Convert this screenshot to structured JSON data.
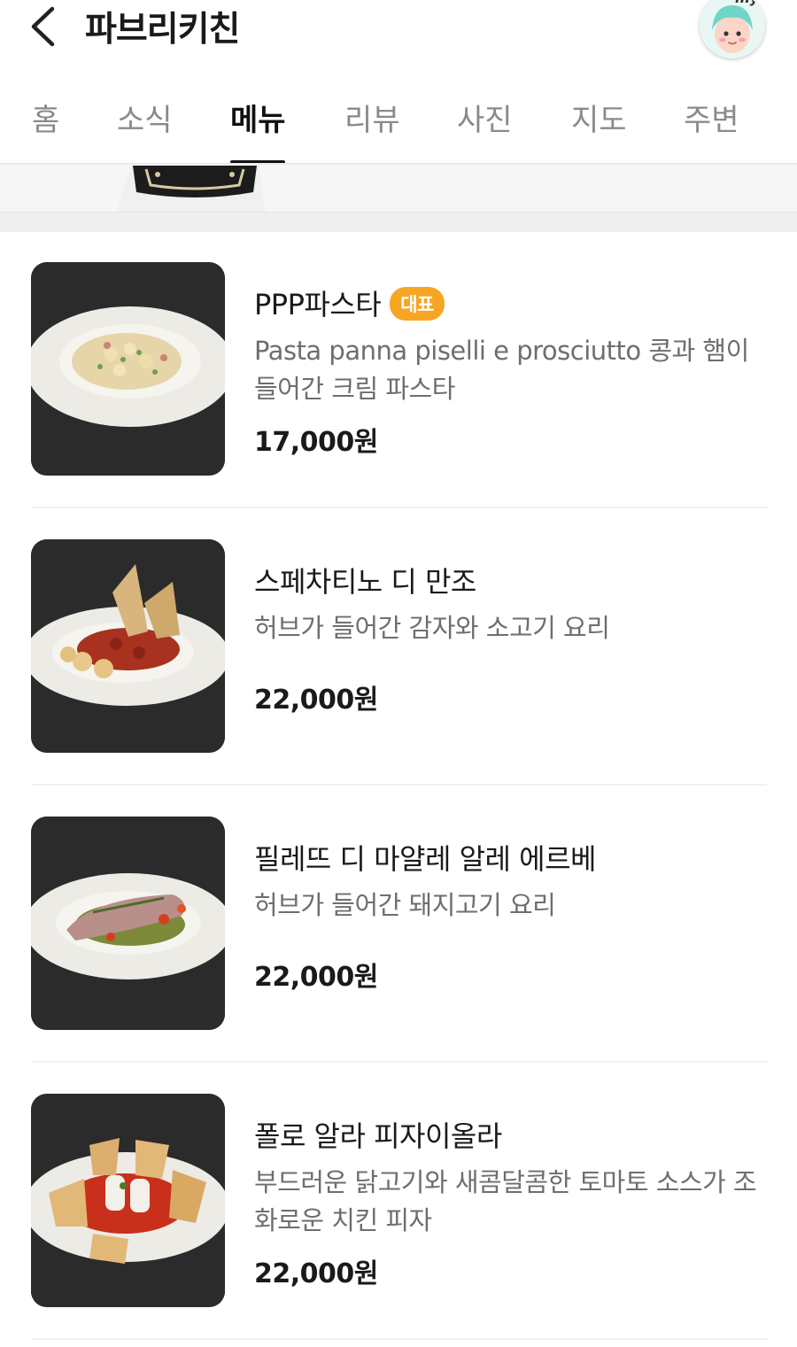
{
  "header": {
    "title": "파브리키친",
    "back_icon": "chevron-left-icon",
    "avatar_text": "my"
  },
  "tabs": [
    {
      "label": "홈",
      "active": false
    },
    {
      "label": "소식",
      "active": false
    },
    {
      "label": "메뉴",
      "active": true
    },
    {
      "label": "리뷰",
      "active": false
    },
    {
      "label": "사진",
      "active": false
    },
    {
      "label": "지도",
      "active": false
    },
    {
      "label": "주변",
      "active": false
    }
  ],
  "colors": {
    "badge": "#f6a623",
    "thumb_bg": "#2d2d2d"
  },
  "menu": [
    {
      "name": "PPP파스타",
      "badge": "대표",
      "desc": "Pasta panna piselli e prosciutto 콩과 햄이 들어간 크림 파스타",
      "price": "17,000원"
    },
    {
      "name": "스페차티노 디 만조",
      "badge": "",
      "desc": "허브가 들어간 감자와 소고기 요리",
      "price": "22,000원"
    },
    {
      "name": "필레뜨 디 마얄레 알레 에르베",
      "badge": "",
      "desc": "허브가 들어간 돼지고기 요리",
      "price": "22,000원"
    },
    {
      "name": "폴로 알라 피자이올라",
      "badge": "",
      "desc": "부드러운 닭고기와 새콤달콤한 토마토 소스가 조화로운 치킨 피자",
      "price": "22,000원"
    }
  ]
}
